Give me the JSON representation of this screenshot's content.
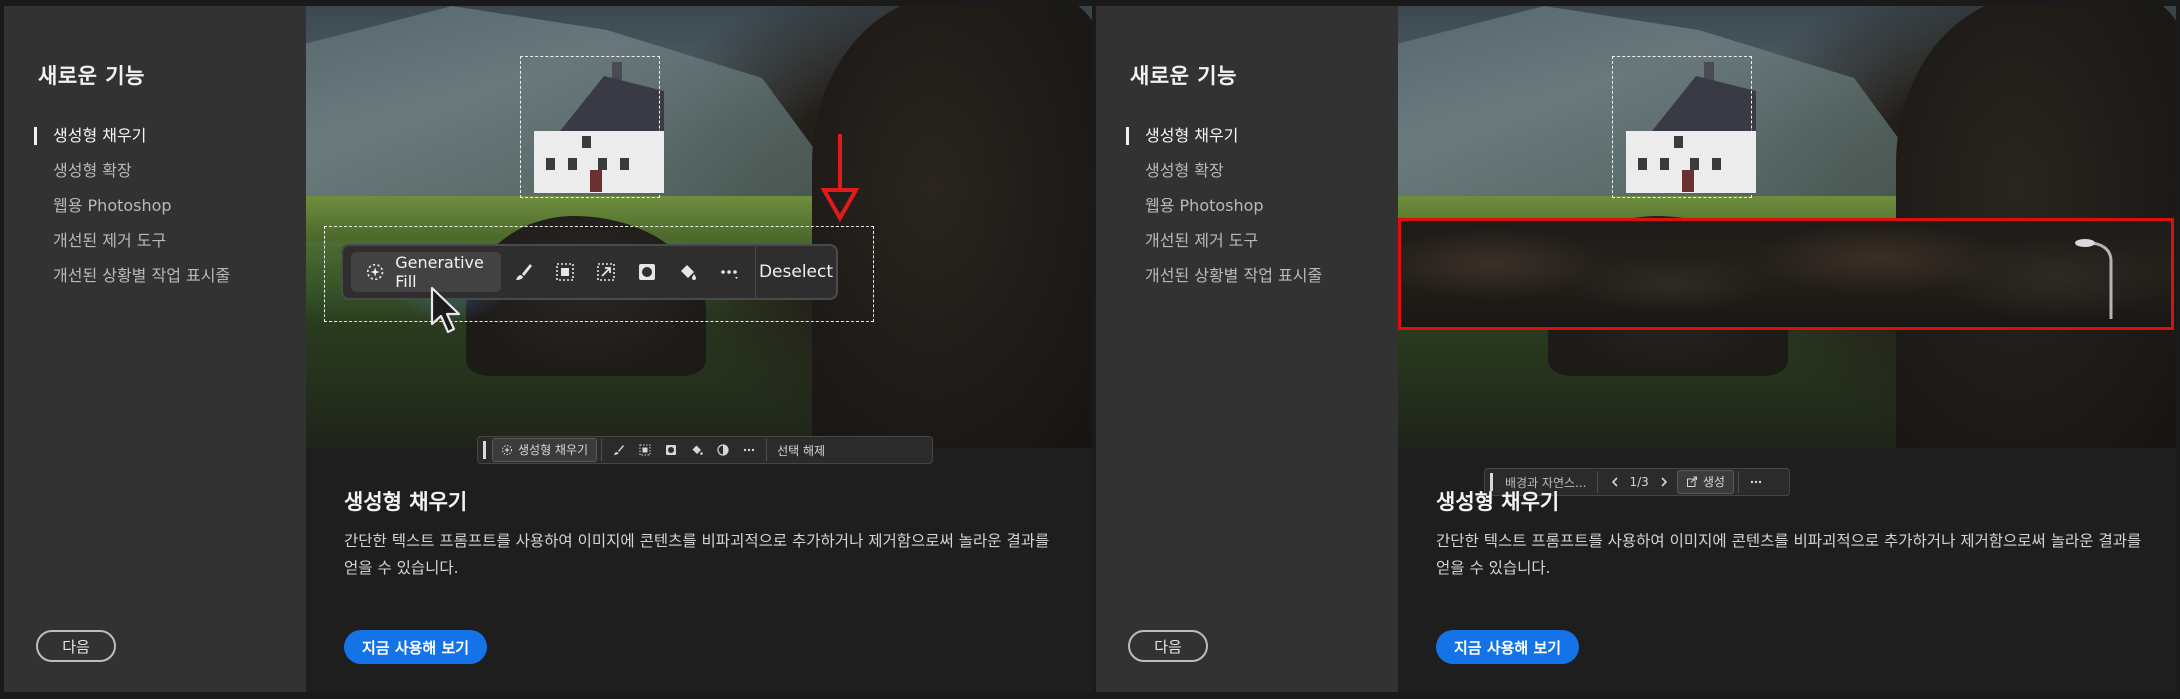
{
  "left": {
    "sidebar": {
      "title": "새로운 기능",
      "items": [
        {
          "label": "생성형 채우기",
          "active": true
        },
        {
          "label": "생성형 확장"
        },
        {
          "label": "웹용 Photoshop"
        },
        {
          "label": "개선된 제거 도구"
        },
        {
          "label": "개선된 상황별 작업 표시줄"
        }
      ],
      "next_label": "다음"
    },
    "toolbar_big": {
      "generative_fill_label": "Generative Fill",
      "deselect_label": "Deselect",
      "icons": [
        "brush-icon",
        "mask-icon",
        "transform-icon",
        "circle-mask-icon",
        "paint-bucket-icon",
        "more-icon"
      ]
    },
    "toolbar_small": {
      "generative_fill_label": "생성형 채우기",
      "deselect_label": "선택 해제"
    },
    "content": {
      "title": "생성형 채우기",
      "description": "간단한 텍스트 프롬프트를 사용하여 이미지에 콘텐츠를 비파괴적으로 추가하거나 제거함으로써 놀라운 결과를 얻을 수 있습니다.",
      "cta_label": "지금 사용해 보기"
    }
  },
  "right": {
    "sidebar": {
      "title": "새로운 기능",
      "items": [
        {
          "label": "생성형 채우기",
          "active": true
        },
        {
          "label": "생성형 확장"
        },
        {
          "label": "웹용 Photoshop"
        },
        {
          "label": "개선된 제거 도구"
        },
        {
          "label": "개선된 상황별 작업 표시줄"
        }
      ],
      "next_label": "다음"
    },
    "toolbar_small": {
      "prompt_label": "배경과 자연스...",
      "page_indicator": "1/3",
      "generate_label": "생성"
    },
    "content": {
      "title": "생성형 채우기",
      "description": "간단한 텍스트 프롬프트를 사용하여 이미지에 콘텐츠를 비파괴적으로 추가하거나 제거함으로써 놀라운 결과를 얻을 수 있습니다.",
      "cta_label": "지금 사용해 보기"
    }
  },
  "colors": {
    "accent": "#1473e6",
    "highlight_red": "#e00d0d",
    "sidebar_bg": "#323232",
    "content_bg": "#1e1e1e"
  }
}
